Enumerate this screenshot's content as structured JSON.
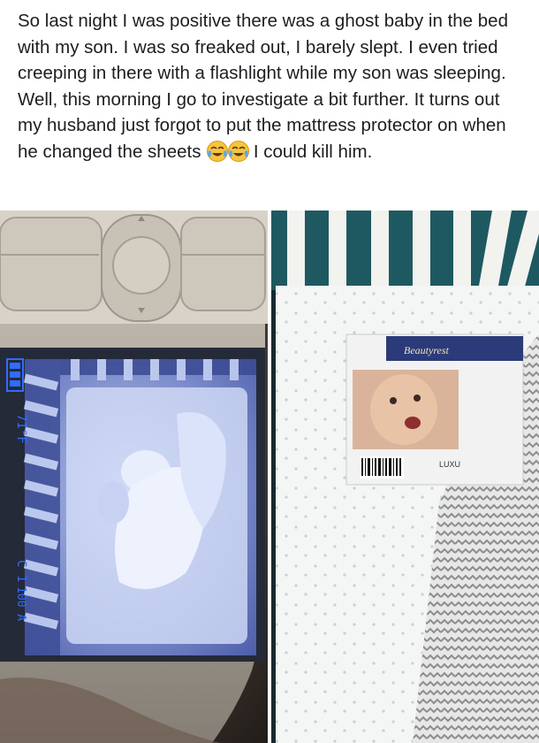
{
  "post": {
    "text_before_emoji": "So last night I was positive there was a ghost baby in the bed with my son. I was so freaked out, I barely slept. I even tried creeping in there with a flashlight while my son was sleeping. Well, this morning I go to investigate a bit further. It turns out my husband just forgot to put the mattress protector on when he changed the sheets ",
    "emojis": [
      "face-with-tears-of-joy",
      "face-with-tears-of-joy"
    ],
    "text_after_emoji": " I could kill him."
  },
  "monitor_display": {
    "temperature": "71°F",
    "channel": "C 1",
    "extra": "100 A"
  },
  "mattress_label": {
    "brand": "Beautyrest",
    "tag": "LUXU"
  },
  "colors": {
    "text": "#1c1e21",
    "night_vision": "#8fa8e8",
    "osd_blue": "#2f6cff",
    "crib_teal": "#1e5961",
    "chevron_gray": "#9a9a9a"
  }
}
